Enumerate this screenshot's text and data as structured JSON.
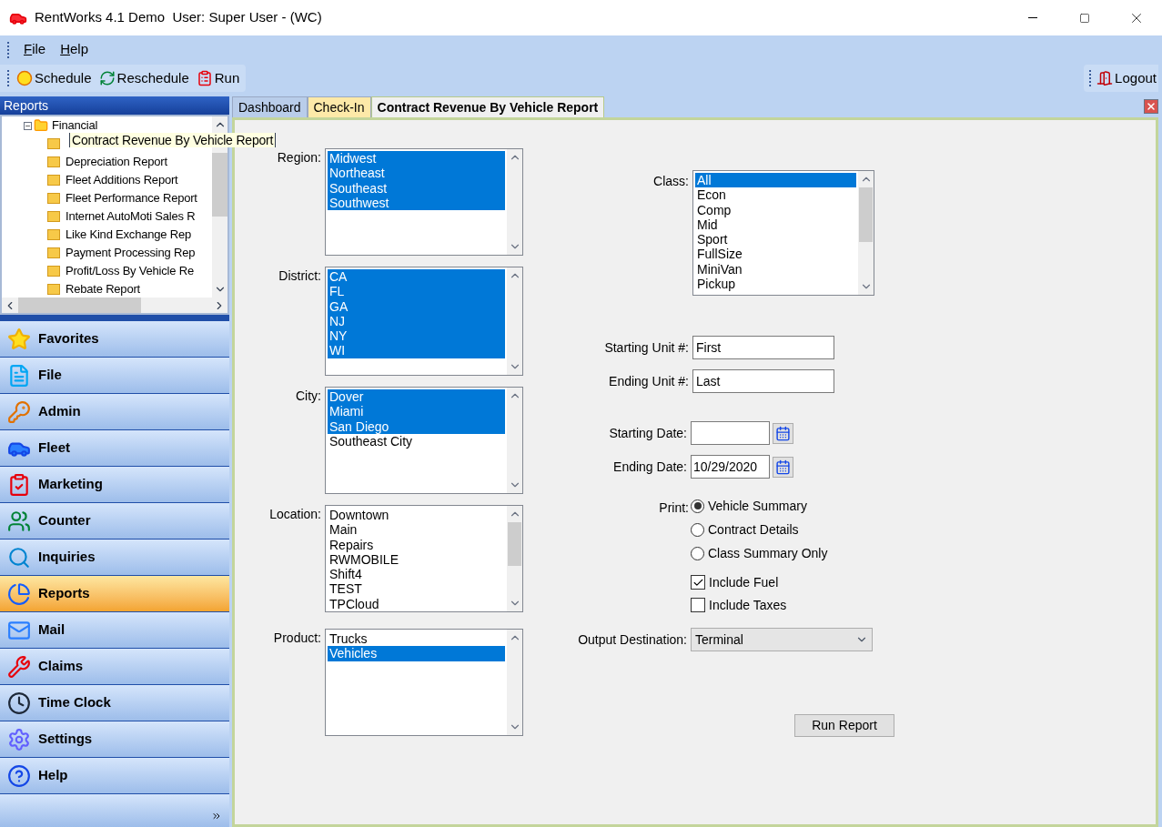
{
  "window": {
    "title": "RentWorks 4.1 Demo  User: Super User - (WC)"
  },
  "menu": [
    {
      "label": "File"
    },
    {
      "label": "Help"
    }
  ],
  "toolbar": [
    {
      "label": "Schedule"
    },
    {
      "label": "Reschedule"
    },
    {
      "label": "Run"
    }
  ],
  "logout": {
    "label": "Logout"
  },
  "sidebar": {
    "title": "Reports",
    "tree": {
      "label": "Financial",
      "expanded": true,
      "children": [
        {
          "tooltip": "Contract Revenue By Vehicle Report"
        },
        {
          "label": "Depreciation Report"
        },
        {
          "label": "Fleet Additions Report"
        },
        {
          "label": "Fleet Performance Report"
        },
        {
          "label": "Internet AutoMoti Sales R"
        },
        {
          "label": "Like Kind Exchange Rep"
        },
        {
          "label": "Payment Processing Rep"
        },
        {
          "label": "Profit/Loss By Vehicle Re"
        },
        {
          "label": "Rebate Report"
        }
      ]
    },
    "nav": [
      {
        "label": "Favorites",
        "selected": false
      },
      {
        "label": "File",
        "selected": false
      },
      {
        "label": "Admin",
        "selected": false
      },
      {
        "label": "Fleet",
        "selected": false
      },
      {
        "label": "Marketing",
        "selected": false
      },
      {
        "label": "Counter",
        "selected": false
      },
      {
        "label": "Inquiries",
        "selected": false
      },
      {
        "label": "Reports",
        "selected": true
      },
      {
        "label": "Mail",
        "selected": false
      },
      {
        "label": "Claims",
        "selected": false
      },
      {
        "label": "Time Clock",
        "selected": false
      },
      {
        "label": "Settings",
        "selected": false
      },
      {
        "label": "Help",
        "selected": false
      }
    ]
  },
  "tabs": [
    {
      "label": "Dashboard",
      "selected": false,
      "color": "#b9cdea"
    },
    {
      "label": "Check-In",
      "selected": false,
      "color": "#fde9a8"
    },
    {
      "label": "Contract Revenue By Vehicle Report",
      "selected": true,
      "color": "#f0f0f0"
    }
  ],
  "filters": [
    {
      "label": "Region:",
      "items": [
        {
          "label": "Midwest",
          "selected": true
        },
        {
          "label": "Northeast",
          "selected": true
        },
        {
          "label": "Southeast",
          "selected": true
        },
        {
          "label": "Southwest",
          "selected": true
        }
      ]
    },
    {
      "label": "District:",
      "items": [
        {
          "label": "CA",
          "selected": true
        },
        {
          "label": "FL",
          "selected": true
        },
        {
          "label": "GA",
          "selected": true
        },
        {
          "label": "NJ",
          "selected": true
        },
        {
          "label": "NY",
          "selected": true
        },
        {
          "label": "WI",
          "selected": true
        }
      ]
    },
    {
      "label": "City:",
      "items": [
        {
          "label": "Dover",
          "selected": true
        },
        {
          "label": "Miami",
          "selected": true
        },
        {
          "label": "San Diego",
          "selected": true
        },
        {
          "label": "Southeast City",
          "selected": false
        }
      ]
    },
    {
      "label": "Location:",
      "items": [
        {
          "label": "Downtown",
          "selected": false
        },
        {
          "label": "Main",
          "selected": false
        },
        {
          "label": "Repairs",
          "selected": false
        },
        {
          "label": "RWMOBILE",
          "selected": false
        },
        {
          "label": "Shift4",
          "selected": false
        },
        {
          "label": "TEST",
          "selected": false
        },
        {
          "label": "TPCloud",
          "selected": false
        }
      ]
    },
    {
      "label": "Product:",
      "items": [
        {
          "label": "Trucks",
          "selected": false
        },
        {
          "label": "Vehicles",
          "selected": true
        }
      ]
    }
  ],
  "class_filter": {
    "label": "Class:",
    "items": [
      {
        "label": "All",
        "selected": true
      },
      {
        "label": "Econ",
        "selected": false
      },
      {
        "label": "Comp",
        "selected": false
      },
      {
        "label": "Mid",
        "selected": false
      },
      {
        "label": "Sport",
        "selected": false
      },
      {
        "label": "FullSize",
        "selected": false
      },
      {
        "label": "MiniVan",
        "selected": false
      },
      {
        "label": "Pickup",
        "selected": false
      }
    ]
  },
  "unit_fields": [
    {
      "label": "Starting Unit #:",
      "value": "First"
    },
    {
      "label": "Ending Unit #:",
      "value": "Last"
    }
  ],
  "date_fields": [
    {
      "label": "Starting Date:"
    },
    {
      "label": "Ending Date:",
      "value": "10/29/2020"
    }
  ],
  "print": {
    "label": "Print:",
    "options": [
      {
        "label": "Vehicle Summary",
        "selected": true
      },
      {
        "label": "Contract Details",
        "selected": false
      },
      {
        "label": "Class Summary Only",
        "selected": false
      }
    ]
  },
  "checkboxes": [
    {
      "label": "Include Fuel",
      "checked": true
    },
    {
      "label": "Include Taxes",
      "checked": false
    }
  ],
  "output": {
    "label": "Output Destination:",
    "value": "Terminal"
  },
  "run_button": "Run Report"
}
